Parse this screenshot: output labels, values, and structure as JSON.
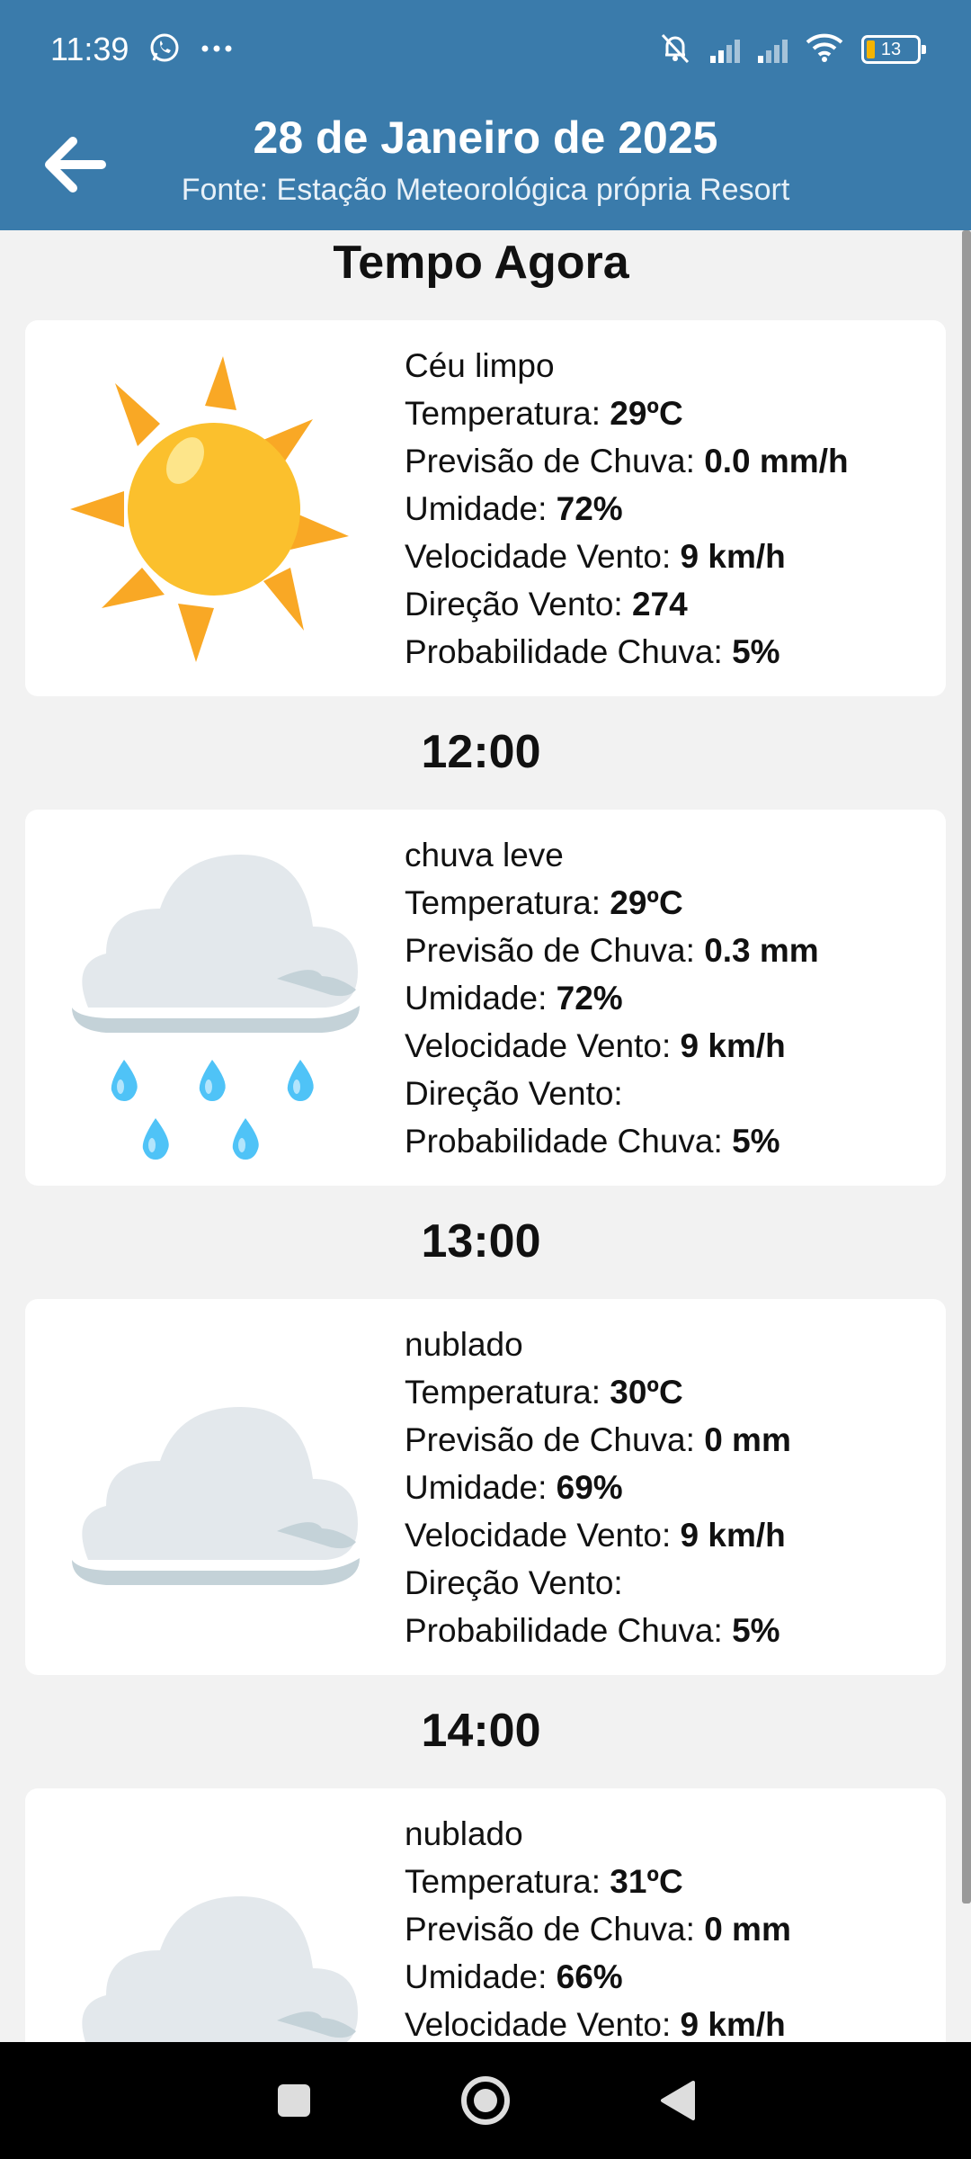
{
  "status_bar": {
    "time": "11:39",
    "battery": "13",
    "icons": [
      "whatsapp-icon",
      "more-dots-icon",
      "muted-bell-icon",
      "signal-h-icon",
      "signal-icon",
      "wifi-icon",
      "battery-icon"
    ]
  },
  "header": {
    "title": "28 de Janeiro de 2025",
    "subtitle": "Fonte: Estação Meteorológica própria Resort"
  },
  "labels": {
    "temperature": "Temperatura: ",
    "rain_forecast": "Previsão de Chuva: ",
    "humidity": "Umidade: ",
    "wind_speed": "Velocidade Vento: ",
    "wind_direction": "Direção Vento: ",
    "rain_probability": "Probabilidade Chuva: "
  },
  "sections": [
    {
      "heading": "Tempo Agora",
      "icon": "sun-icon",
      "condition": "Céu limpo",
      "temperature": "29ºC",
      "rain_forecast": "0.0 mm/h",
      "humidity": "72%",
      "wind_speed": "9 km/h",
      "wind_direction": "274",
      "rain_probability": "5%"
    },
    {
      "heading": "12:00",
      "icon": "rain-cloud-icon",
      "condition": "chuva leve",
      "temperature": "29ºC",
      "rain_forecast": "0.3 mm",
      "humidity": "72%",
      "wind_speed": "9 km/h",
      "wind_direction": "",
      "rain_probability": "5%"
    },
    {
      "heading": "13:00",
      "icon": "cloud-icon",
      "condition": "nublado",
      "temperature": "30ºC",
      "rain_forecast": "0 mm",
      "humidity": "69%",
      "wind_speed": "9 km/h",
      "wind_direction": "",
      "rain_probability": "5%"
    },
    {
      "heading": "14:00",
      "icon": "cloud-icon",
      "condition": "nublado",
      "temperature": "31ºC",
      "rain_forecast": "0 mm",
      "humidity": "66%",
      "wind_speed": "9 km/h",
      "wind_direction": "",
      "rain_probability": ""
    }
  ],
  "colors": {
    "header_bg": "#3a7bab",
    "sun": "#fbc02d",
    "sun_rays": "#f9a825",
    "cloud": "#e3e8ec",
    "cloud_shadow": "#c4d2d8",
    "raindrop": "#4fc3f7"
  }
}
